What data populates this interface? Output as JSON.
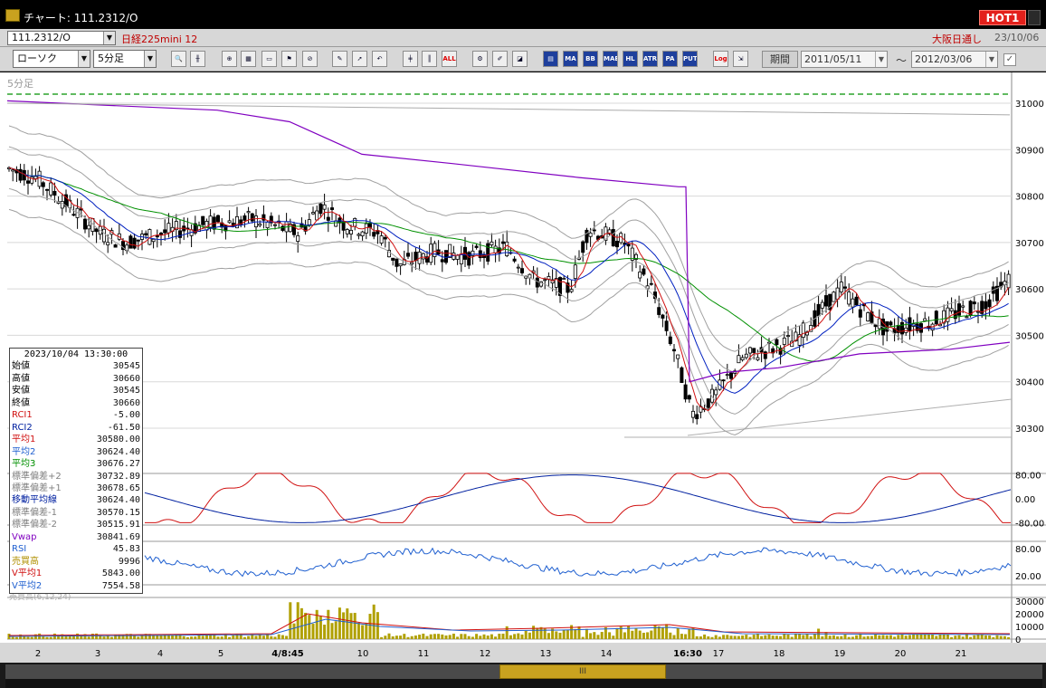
{
  "window": {
    "title": "チャート: 111.2312/O",
    "hot_badge": "HOT1"
  },
  "row1": {
    "symbol": "111.2312/O",
    "instrument": "日経225mini 12",
    "exchange": "大阪日通し",
    "date": "23/10/06"
  },
  "row2": {
    "chart_type": "ローソク",
    "interval": "5分足",
    "tools": [
      "zoom",
      "cursor",
      "scroll",
      "chart",
      "clear",
      "draw",
      "pointer",
      "undo",
      "bars",
      "all",
      "tools",
      "pen",
      "color",
      "indicators"
    ],
    "tool_labels": {
      "all": "ALL",
      "ma": "MA",
      "bb": "BB",
      "mae": "MAE",
      "hl": "HL",
      "atr": "ATR",
      "para": "PA RA",
      "put": "PUT",
      "log": "Log"
    },
    "period_label": "期間",
    "date_from": "2011/05/11",
    "tilde": "～",
    "date_to": "2012/03/06"
  },
  "chart": {
    "label": "5分足",
    "price_ticks": [
      "31000",
      "30900",
      "30800",
      "30700",
      "30600",
      "30500",
      "30400",
      "30300"
    ],
    "rci_ticks": [
      "80.00",
      "0.00",
      "-80.00"
    ],
    "rsi_ticks": [
      "80.00",
      "20.00"
    ],
    "vol_ticks": [
      "30000",
      "20000",
      "10000",
      "0"
    ],
    "x_labels": [
      "2",
      "3",
      "4",
      "5",
      "4/8:45",
      "10",
      "11",
      "12",
      "13",
      "14",
      "16:30",
      "17",
      "18",
      "19",
      "20",
      "21"
    ],
    "volume_label": "売買高(6,12,24)",
    "colors": {
      "up": "#ffffff",
      "down": "#000000",
      "ma1": "#d01010",
      "ma2": "#0020c0",
      "ma3": "#009000",
      "vwap": "#8000c0",
      "rci": "#d01010",
      "rci2": "#0020a0",
      "rsi": "#2060d0",
      "volume": "#b0a000",
      "green_dash": "#009000"
    }
  },
  "databox": {
    "datetime": "2023/10/04 13:30:00",
    "rows": [
      {
        "k": "始値",
        "v": "30545",
        "color": "#000000"
      },
      {
        "k": "高値",
        "v": "30660",
        "color": "#000000"
      },
      {
        "k": "安値",
        "v": "30545",
        "color": "#000000"
      },
      {
        "k": "終値",
        "v": "30660",
        "color": "#000000"
      },
      {
        "k": "RCI1",
        "v": "-5.00",
        "color": "#d01010"
      },
      {
        "k": "RCI2",
        "v": "-61.50",
        "color": "#0020a0"
      },
      {
        "k": "平均1",
        "v": "30580.00",
        "color": "#d01010"
      },
      {
        "k": "平均2",
        "v": "30624.40",
        "color": "#2060d0"
      },
      {
        "k": "平均3",
        "v": "30676.27",
        "color": "#009000"
      },
      {
        "k": "標準偏差+2",
        "v": "30732.89",
        "color": "#808080"
      },
      {
        "k": "標準偏差+1",
        "v": "30678.65",
        "color": "#808080"
      },
      {
        "k": "移動平均線",
        "v": "30624.40",
        "color": "#0020a0"
      },
      {
        "k": "標準偏差-1",
        "v": "30570.15",
        "color": "#808080"
      },
      {
        "k": "標準偏差-2",
        "v": "30515.91",
        "color": "#808080"
      },
      {
        "k": "Vwap",
        "v": "30841.69",
        "color": "#8000c0"
      },
      {
        "k": "RSI",
        "v": "45.83",
        "color": "#2060d0"
      },
      {
        "k": "売買高",
        "v": "9996",
        "color": "#b09000"
      },
      {
        "k": "V平均1",
        "v": "5843.00",
        "color": "#d01010"
      },
      {
        "k": "V平均2",
        "v": "7554.58",
        "color": "#2060d0"
      }
    ]
  },
  "scrollbar": {
    "thumb_label": "III"
  }
}
